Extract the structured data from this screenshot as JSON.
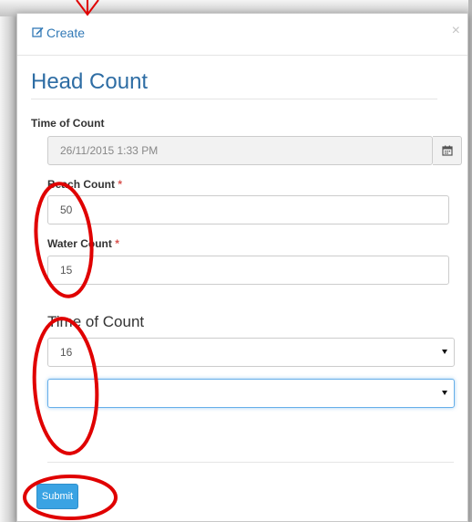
{
  "modal": {
    "header_title": "Create",
    "close_label": "×"
  },
  "form": {
    "title": "Head Count",
    "time_of_count": {
      "label": "Time of Count",
      "value": "26/11/2015 1:33 PM"
    },
    "beach_count": {
      "label": "Beach Count",
      "required_mark": "*",
      "value": "50"
    },
    "water_count": {
      "label": "Water Count",
      "required_mark": "*",
      "value": "15"
    },
    "time_section": {
      "title": "Time of Count",
      "hour_select_value": "16",
      "minute_select_value": ""
    },
    "submit_label": "Submit"
  },
  "icons": {
    "header": "edit-icon",
    "date_addon": "calendar-icon",
    "select_caret": "caret-down-icon"
  },
  "colors": {
    "link_blue": "#337ab7",
    "heading_blue": "#2e6da4",
    "submit_blue": "#3aa3e3",
    "required_red": "#d9534f",
    "annotation_red": "#e00000"
  }
}
